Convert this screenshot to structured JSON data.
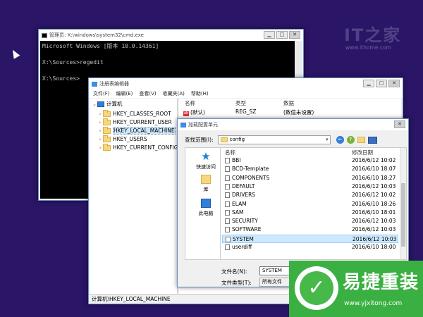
{
  "watermark": {
    "logo": "IT之家",
    "url": "www.ithome.com"
  },
  "cmd": {
    "title": "管理员: X:\\windows\\system32\\cmd.exe",
    "lines": [
      "Microsoft Windows [版本 10.0.14361]",
      "",
      "X:\\Sources>regedit",
      "",
      "X:\\Sources>"
    ]
  },
  "regedit": {
    "title": "注册表编辑器",
    "menu": [
      "文件(F)",
      "编辑(E)",
      "查看(V)",
      "收藏夹(A)",
      "帮助(H)"
    ],
    "tree": {
      "root": "计算机",
      "items": [
        "HKEY_CLASSES_ROOT",
        "HKEY_CURRENT_USER",
        "HKEY_LOCAL_MACHINE",
        "HKEY_USERS",
        "HKEY_CURRENT_CONFIG"
      ]
    },
    "columns": [
      "名称",
      "类型",
      "数据"
    ],
    "values": [
      {
        "name": "(默认)",
        "type": "REG_SZ",
        "data": "(数值未设置)"
      }
    ],
    "status": "计算机\\HKEY_LOCAL_MACHINE"
  },
  "dialog": {
    "title": "加载配置单元",
    "look_in_label": "查找范围(I):",
    "look_in_value": "config",
    "places": [
      "快速访问",
      "库",
      "此电脑"
    ],
    "columns": [
      "名称",
      "修改日期"
    ],
    "files": [
      {
        "name": "BBI",
        "date": "2016/6/12 10:02"
      },
      {
        "name": "BCD-Template",
        "date": "2016/6/10 18:07"
      },
      {
        "name": "COMPONENTS",
        "date": "2016/6/10 18:27"
      },
      {
        "name": "DEFAULT",
        "date": "2016/6/12 10:03"
      },
      {
        "name": "DRIVERS",
        "date": "2016/6/12 10:02"
      },
      {
        "name": "ELAM",
        "date": "2016/6/10 18:26"
      },
      {
        "name": "SAM",
        "date": "2016/6/10 18:01"
      },
      {
        "name": "SECURITY",
        "date": "2016/6/12 10:03"
      },
      {
        "name": "SOFTWARE",
        "date": "2016/6/12 10:03"
      },
      {
        "name": "SYSTEM",
        "date": "2016/6/12 10:03"
      },
      {
        "name": "userdiff",
        "date": "2016/6/10 18:00"
      }
    ],
    "selected_file": "SYSTEM",
    "filename_label": "文件名(N):",
    "filename_value": "SYSTEM",
    "filetype_label": "文件类型(T):",
    "filetype_value": "所有文件"
  },
  "badge": {
    "name": "易捷重装",
    "url": "www.yjxitong.com"
  }
}
